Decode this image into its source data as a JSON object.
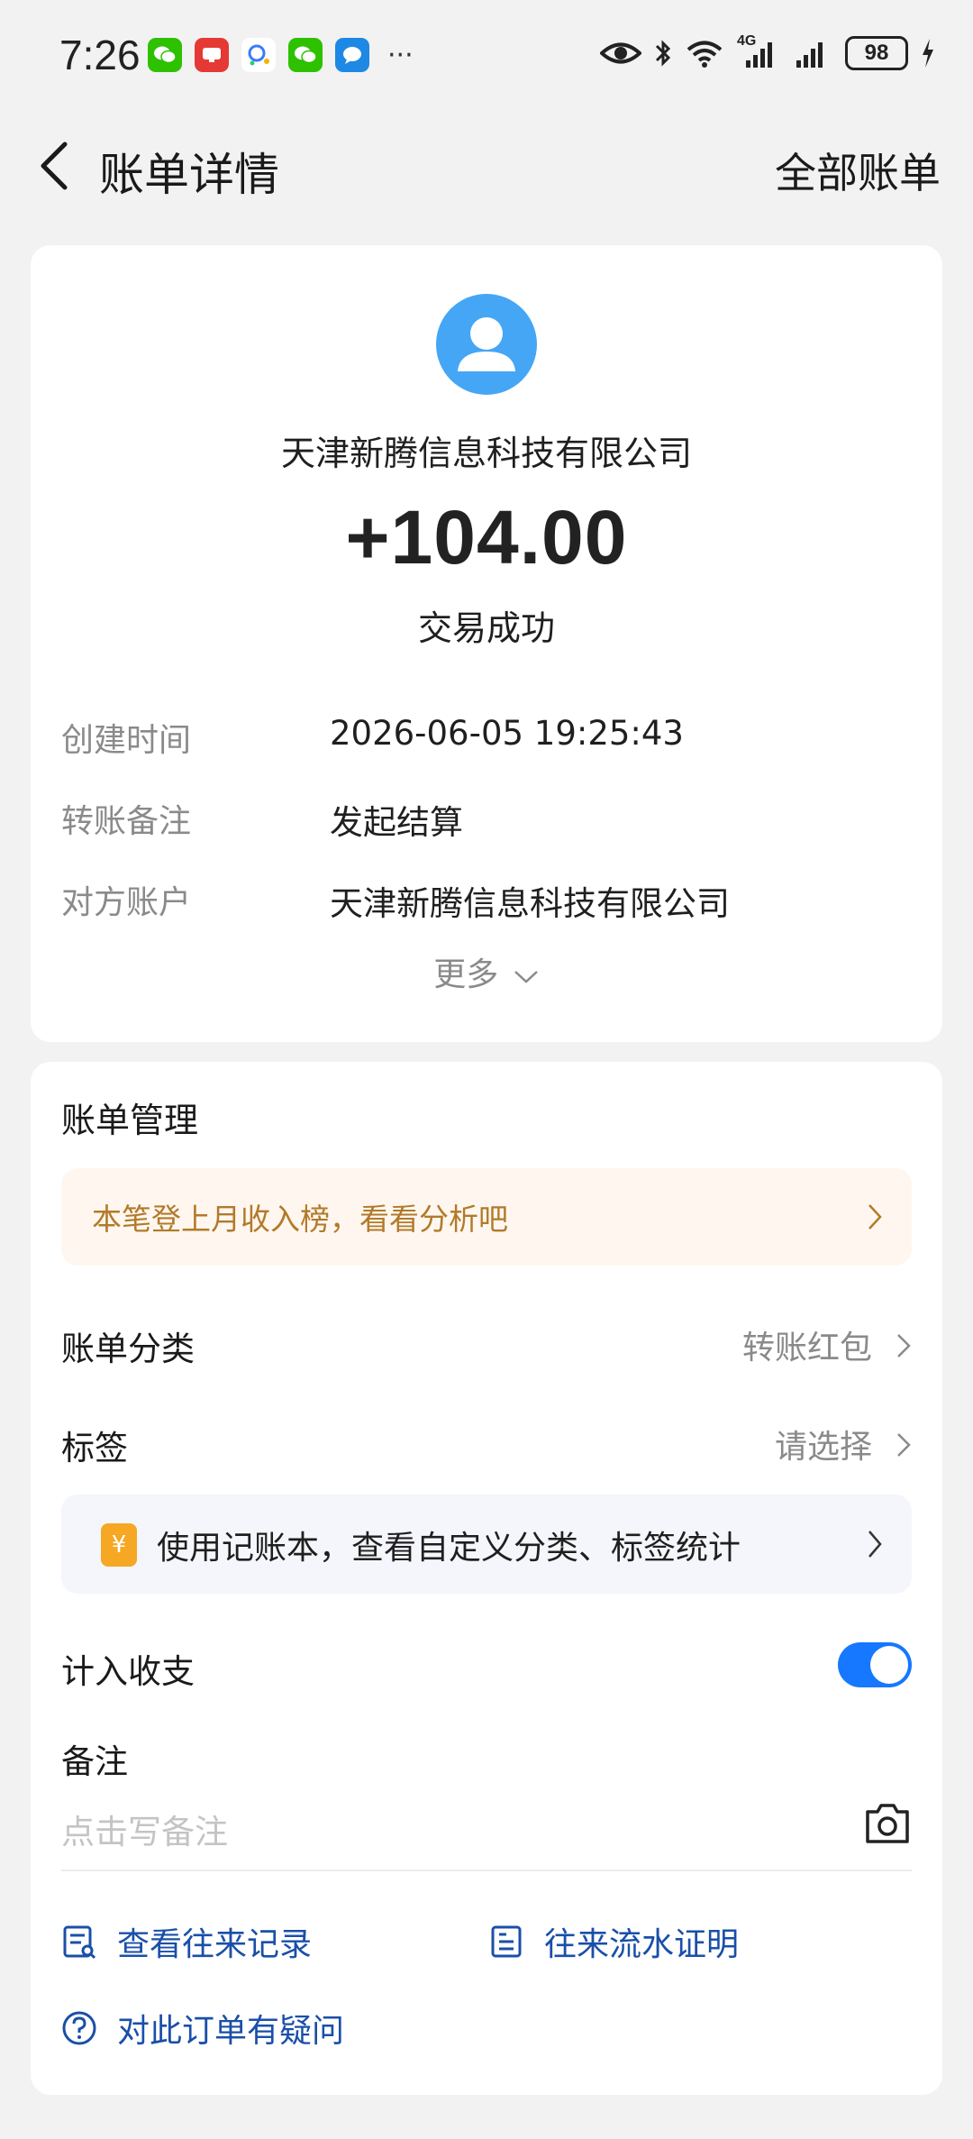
{
  "status_bar": {
    "time": "7:26",
    "apps": [
      {
        "icon": "wechat-icon",
        "color": "#2dc100"
      },
      {
        "icon": "news-app-icon",
        "color": "#e53935"
      },
      {
        "icon": "search-app-icon",
        "color": "#ffffff"
      },
      {
        "icon": "wechat-icon",
        "color": "#2dc100"
      },
      {
        "icon": "message-app-icon",
        "color": "#1e88e5"
      }
    ],
    "more": "···",
    "signal_label": "4G",
    "battery": "98"
  },
  "header": {
    "title": "账单详情",
    "right_action": "全部账单"
  },
  "bill": {
    "merchant": "天津新腾信息科技有限公司",
    "amount": "+104.00",
    "status": "交易成功",
    "details": [
      {
        "label": "创建时间",
        "value": "2026-06-05 19:25:43"
      },
      {
        "label": "转账备注",
        "value": "发起结算"
      },
      {
        "label": "对方账户",
        "value": "天津新腾信息科技有限公司"
      }
    ],
    "more_label": "更多"
  },
  "management": {
    "title": "账单管理",
    "promo": "本笔登上月收入榜，看看分析吧",
    "category": {
      "label": "账单分类",
      "value": "转账红包"
    },
    "tag": {
      "label": "标签",
      "value": "请选择"
    },
    "ledger_banner": "使用记账本，查看自定义分类、标签统计",
    "ledger_icon_glyph": "¥",
    "include_label": "计入收支",
    "include_on": true,
    "note_label": "备注",
    "note_placeholder": "点击写备注",
    "links": {
      "history": "查看往来记录",
      "certificate": "往来流水证明",
      "question": "对此订单有疑问"
    }
  },
  "colors": {
    "accent": "#1677ff",
    "link": "#1a4fa8",
    "promo_text": "#b27a2a",
    "avatar": "#45a6f5"
  }
}
